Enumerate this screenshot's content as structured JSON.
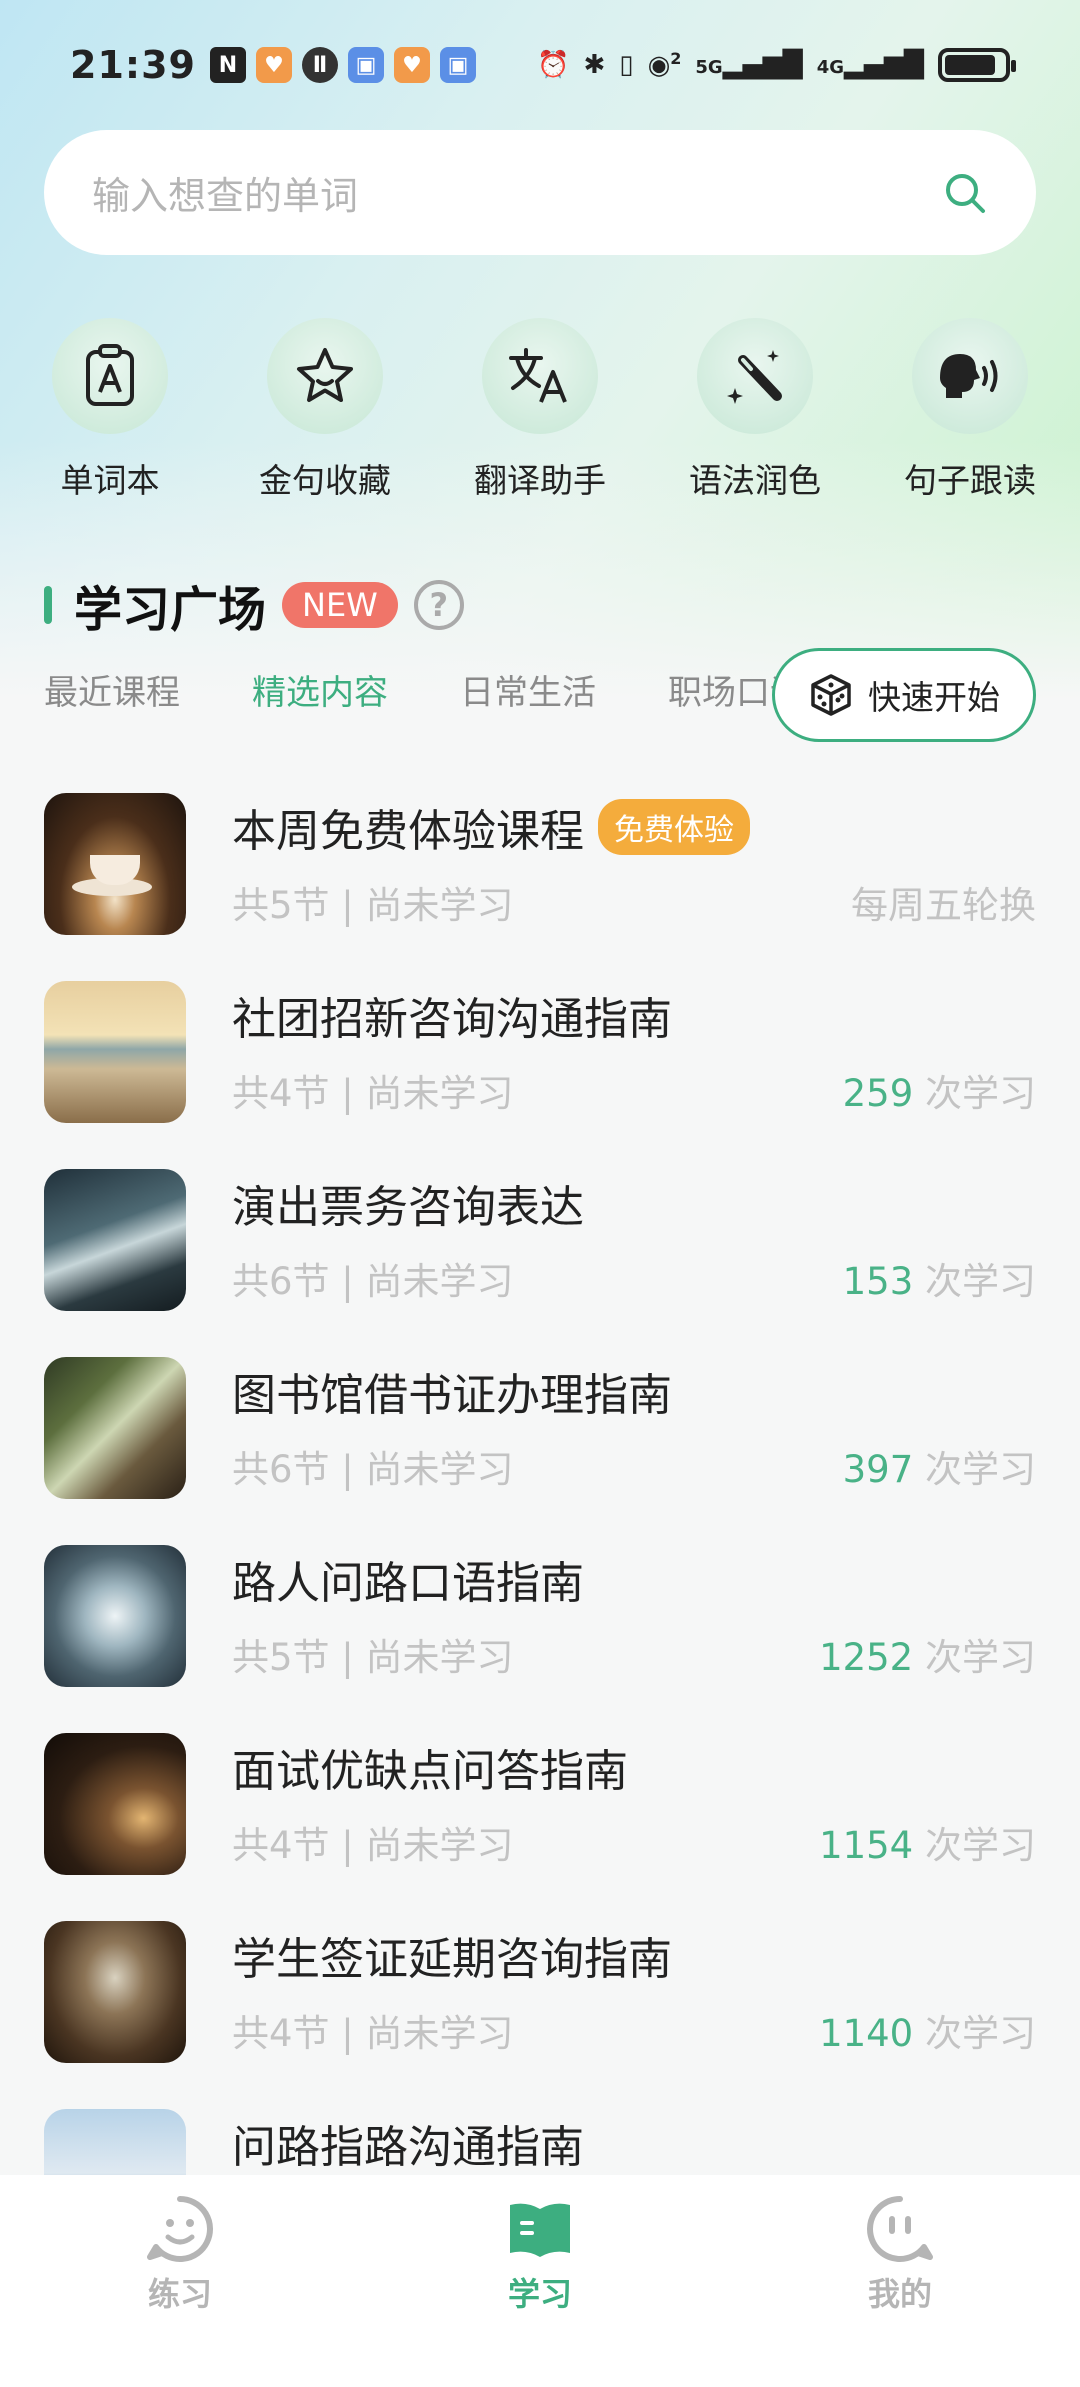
{
  "status_bar": {
    "time": "21:39",
    "network_labels": [
      "2",
      "5G",
      "4G"
    ],
    "icons": [
      "nfc-icon",
      "app-notification-icon",
      "alarm-icon",
      "bluetooth-icon",
      "vibrate-icon",
      "hotspot-icon",
      "signal-icon",
      "battery-icon"
    ]
  },
  "search": {
    "placeholder": "输入想查的单词"
  },
  "quick_actions": [
    {
      "label": "单词本",
      "icon": "vocabulary-book-icon"
    },
    {
      "label": "金句收藏",
      "icon": "star-icon"
    },
    {
      "label": "翻译助手",
      "icon": "translate-icon"
    },
    {
      "label": "语法润色",
      "icon": "magic-wand-icon"
    },
    {
      "label": "句子跟读",
      "icon": "speaking-icon"
    }
  ],
  "section": {
    "title": "学习广场",
    "badge": "NEW",
    "help": "?"
  },
  "tabs": [
    {
      "label": "最近课程",
      "active": false
    },
    {
      "label": "精选内容",
      "active": true
    },
    {
      "label": "日常生活",
      "active": false
    },
    {
      "label": "职场口语",
      "active": false
    }
  ],
  "quick_start": {
    "label": "快速开始"
  },
  "courses": [
    {
      "title": "本周免费体验课程",
      "badge": "免费体验",
      "meta": "共5节 | 尚未学习",
      "count": "",
      "count_suffix": "每周五轮换"
    },
    {
      "title": "社团招新咨询沟通指南",
      "badge": "",
      "meta": "共4节 | 尚未学习",
      "count": "259",
      "count_suffix": " 次学习"
    },
    {
      "title": "演出票务咨询表达",
      "badge": "",
      "meta": "共6节 | 尚未学习",
      "count": "153",
      "count_suffix": " 次学习"
    },
    {
      "title": "图书馆借书证办理指南",
      "badge": "",
      "meta": "共6节 | 尚未学习",
      "count": "397",
      "count_suffix": " 次学习"
    },
    {
      "title": "路人问路口语指南",
      "badge": "",
      "meta": "共5节 | 尚未学习",
      "count": "1252",
      "count_suffix": " 次学习"
    },
    {
      "title": "面试优缺点问答指南",
      "badge": "",
      "meta": "共4节 | 尚未学习",
      "count": "1154",
      "count_suffix": " 次学习"
    },
    {
      "title": "学生签证延期咨询指南",
      "badge": "",
      "meta": "共4节 | 尚未学习",
      "count": "1140",
      "count_suffix": " 次学习"
    },
    {
      "title": "问路指路沟通指南",
      "badge": "",
      "meta": "",
      "count": "",
      "count_suffix": ""
    }
  ],
  "bottom_nav": [
    {
      "label": "练习",
      "active": false
    },
    {
      "label": "学习",
      "active": true
    },
    {
      "label": "我的",
      "active": false
    }
  ],
  "colors": {
    "accent": "#3dae80",
    "new_badge": "#f07569",
    "free_badge": "#f4ac3c"
  }
}
